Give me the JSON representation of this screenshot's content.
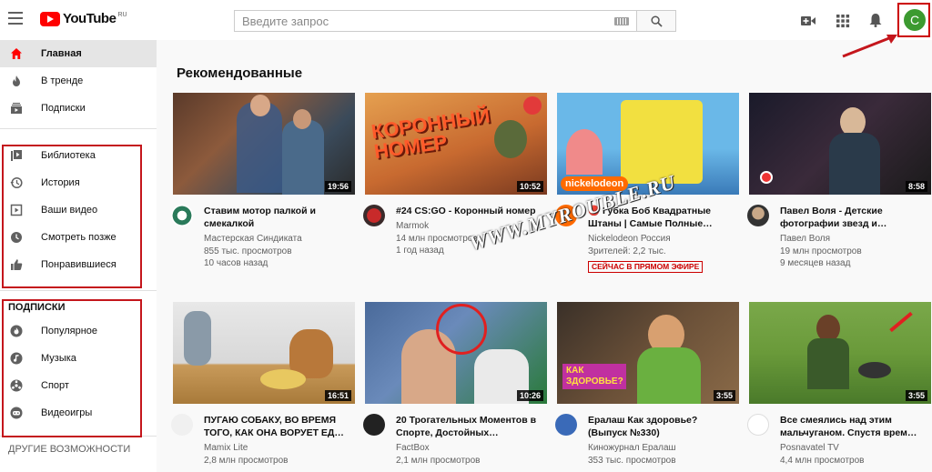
{
  "header": {
    "logo_text": "YouTube",
    "logo_region": "RU",
    "search_placeholder": "Введите запрос"
  },
  "sidebar": {
    "main_items": [
      {
        "label": "Главная",
        "icon": "home-icon"
      },
      {
        "label": "В тренде",
        "icon": "fire-icon"
      },
      {
        "label": "Подписки",
        "icon": "subscriptions-icon"
      }
    ],
    "library_items": [
      {
        "label": "Библиотека",
        "icon": "library-icon"
      },
      {
        "label": "История",
        "icon": "history-icon"
      },
      {
        "label": "Ваши видео",
        "icon": "your-videos-icon"
      },
      {
        "label": "Смотреть позже",
        "icon": "clock-icon"
      },
      {
        "label": "Понравившиеся",
        "icon": "thumbs-up-icon"
      }
    ],
    "subscriptions_title": "ПОДПИСКИ",
    "subscriptions": [
      {
        "label": "Популярное",
        "icon": "popular-icon"
      },
      {
        "label": "Музыка",
        "icon": "music-icon"
      },
      {
        "label": "Спорт",
        "icon": "sport-icon"
      },
      {
        "label": "Видеоигры",
        "icon": "gaming-icon"
      }
    ],
    "more_title": "ДРУГИЕ ВОЗМОЖНОСТИ"
  },
  "avatar_letter": "C",
  "main": {
    "heading": "Рекомендованные",
    "videos": [
      {
        "title": "Ставим мотор палкой и смекалкой",
        "channel": "Мастерская Синдиката",
        "views": "855 тыс. просмотров",
        "age": "10 часов назад",
        "duration": "19:56"
      },
      {
        "title": "#24 CS:GO - Коронный номер",
        "channel": "Marmok",
        "views": "14 млн просмотров",
        "age": "1 год назад",
        "duration": "10:52",
        "thumb_text": "КОРОННЫЙ НОМЕР"
      },
      {
        "title": "🔴 Губка Боб Квадратные Штаны | Самые Полные…",
        "channel": "Nickelodeon Россия",
        "views": "Зрителей: 2,2 тыс.",
        "live": "СЕЙЧАС В ПРЯМОМ ЭФИРЕ",
        "thumb_text": "nickelodeon"
      },
      {
        "title": "Павел Воля - Детские фотографии звезд и…",
        "channel": "Павел Воля",
        "views": "19 млн просмотров",
        "age": "9 месяцев назад",
        "duration": "8:58"
      },
      {
        "title": "ПУГАЮ СОБАКУ, ВО ВРЕМЯ ТОГО, КАК ОНА ВОРУЕТ ЕД…",
        "channel": "Mamix Lite",
        "views": "2,8 млн просмотров",
        "duration": "16:51"
      },
      {
        "title": "20 Трогательных Моментов в Спорте, Достойных…",
        "channel": "FactBox",
        "views": "2,1 млн просмотров",
        "duration": "10:26"
      },
      {
        "title": "Ералаш Как здоровье? (Выпуск №330)",
        "channel": "Киножурнал Ералаш",
        "views": "353 тыс. просмотров",
        "duration": "3:55",
        "thumb_text": "КАК ЗДОРОВЬЕ?"
      },
      {
        "title": "Все смеялись над этим мальчуганом. Спустя врем…",
        "channel": "Posnavatel TV",
        "views": "4,4 млн просмотров",
        "duration": "3:55"
      }
    ]
  },
  "watermark": "WWW.MYROUBLE.RU",
  "colors": {
    "brand_red": "#ff0000",
    "highlight_red": "#c4161c",
    "avatar_green": "#3c9a30"
  }
}
